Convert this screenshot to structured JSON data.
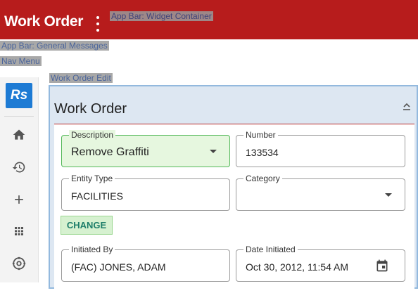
{
  "appbar": {
    "title": "Work Order",
    "widget_container_label": "App Bar: Widget Container",
    "general_messages_label": "App Bar: General Messages",
    "nav_menu_label": "Nav Menu"
  },
  "sidebar": {
    "logo_text": "Rs",
    "items": [
      {
        "icon": "home-icon"
      },
      {
        "icon": "history-icon"
      },
      {
        "icon": "add-icon"
      },
      {
        "icon": "apps-grid-icon"
      },
      {
        "icon": "settings-icon"
      }
    ]
  },
  "panel": {
    "debug_label": "Work Order Edit",
    "title": "Work Order",
    "fields": {
      "description": {
        "label": "Description",
        "value": "Remove Graffiti"
      },
      "number": {
        "label": "Number",
        "value": "133534"
      },
      "entity_type": {
        "label": "Entity Type",
        "value": "FACILITIES"
      },
      "category": {
        "label": "Category",
        "value": ""
      },
      "initiated_by": {
        "label": "Initiated By",
        "value": "(FAC) JONES, ADAM"
      },
      "date_initiated": {
        "label": "Date Initiated",
        "value": "Oct 30, 2012, 11:54 AM"
      }
    },
    "change_button": "CHANGE"
  },
  "colors": {
    "appbar": "#b71c1c",
    "accent": "#1e7bd4",
    "selected_field": "#e6f7df",
    "panel_bg": "#dde7f2"
  }
}
